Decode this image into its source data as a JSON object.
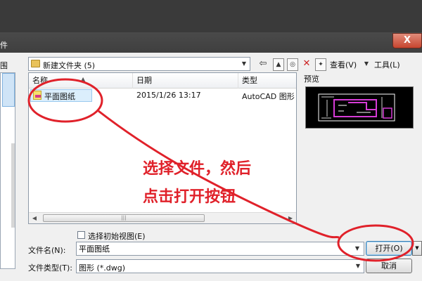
{
  "window": {
    "title_fragment": "件",
    "close_label": "X"
  },
  "left": {
    "look_in_fragment": "围"
  },
  "look_in": {
    "value": "新建文件夹",
    "count": "(5)"
  },
  "toolbar": {
    "view_label": "查看(V)",
    "tools_label": "工具(L)"
  },
  "file_list": {
    "columns": [
      "名称",
      "日期",
      "类型"
    ],
    "rows": [
      {
        "name": "平面图纸",
        "date": "2015/1/26 13:17",
        "type": "AutoCAD 图形"
      }
    ]
  },
  "preview": {
    "label": "预览"
  },
  "options": {
    "initial_view_label": "选择初始视图(E)"
  },
  "filename": {
    "label": "文件名(N):",
    "value": "平面图纸"
  },
  "filetype": {
    "label": "文件类型(T):",
    "value": "图形 (*.dwg)"
  },
  "buttons": {
    "open": "打开(O)",
    "cancel": "取消"
  },
  "annotation": {
    "line1": "选择文件，然后",
    "line2": "点击打开按钮",
    "color": "#e0212a"
  }
}
